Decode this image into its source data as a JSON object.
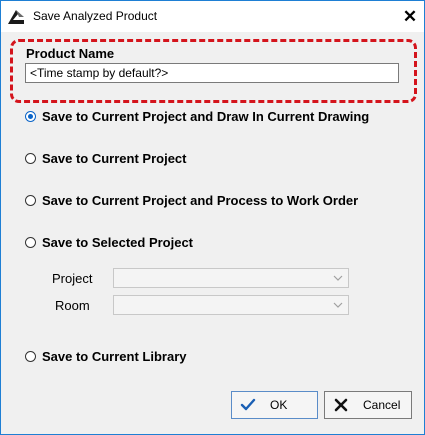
{
  "window": {
    "title": "Save Analyzed Product",
    "close_symbol": "✕"
  },
  "product": {
    "label": "Product Name",
    "value": "<Time stamp by default?>"
  },
  "options": [
    {
      "label": "Save to Current Project and Draw In Current Drawing",
      "checked": true
    },
    {
      "label": "Save to Current Project",
      "checked": false
    },
    {
      "label": "Save to Current Project and Process to Work Order",
      "checked": false
    },
    {
      "label": "Save to Selected Project",
      "checked": false
    },
    {
      "label": "Save to Current Library",
      "checked": false
    }
  ],
  "fields": {
    "project_label": "Project",
    "room_label": "Room",
    "project_value": "",
    "room_value": ""
  },
  "buttons": {
    "ok_label": "OK",
    "cancel_label": "Cancel"
  },
  "colors": {
    "accent": "#0a64c8",
    "highlight": "#d4141c",
    "window_border": "#1e7fd4"
  }
}
